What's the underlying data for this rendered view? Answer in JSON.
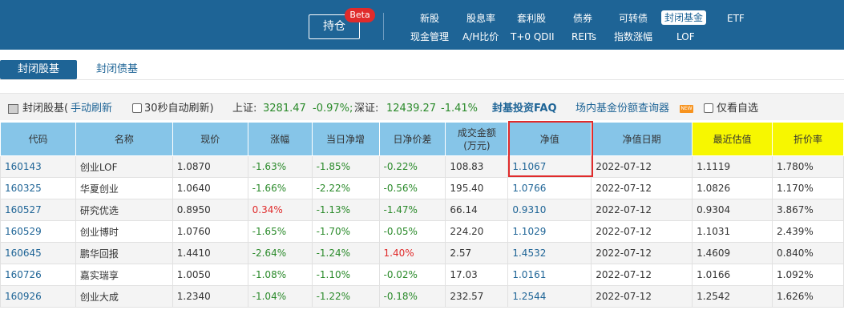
{
  "topbar": {
    "holding_label": "持仓",
    "beta_label": "Beta",
    "nav_row1": [
      "新股",
      "股息率",
      "套利股",
      "债券",
      "可转债",
      "封闭基金",
      "ETF"
    ],
    "nav_row2": [
      "现金管理",
      "A/H比价",
      "T+0 QDII",
      "REITs",
      "指数涨幅",
      "LOF"
    ],
    "active_nav": "封闭基金"
  },
  "tabs": [
    "封闭股基",
    "封闭债基"
  ],
  "infobar": {
    "title": "封闭股基(",
    "manual_refresh": "手动刷新",
    "auto_refresh": "30秒自动刷新)",
    "sh_label": "上证:",
    "sh_value": "3281.47",
    "sh_change": "-0.97%;",
    "sz_label": "深证:",
    "sz_value": "12439.27",
    "sz_change": "-1.41%",
    "faq_link": "封基投资FAQ",
    "query_link": "场内基金份额查询器",
    "new_badge": "NEW",
    "watchlist_only": "仅看自选"
  },
  "table": {
    "headers": [
      "代码",
      "名称",
      "现价",
      "涨幅",
      "当日净增",
      "日净价差",
      "成交金额(万元)",
      "净值",
      "净值日期",
      "最近估值",
      "折价率"
    ],
    "header_amount_line1": "成交金额",
    "header_amount_line2": "(万元)",
    "rows": [
      {
        "code": "160143",
        "name": "创业LOF",
        "price": "1.0870",
        "change": "-1.63%",
        "daily_nav_change": "-1.85%",
        "daily_spread": "-0.22%",
        "amount": "108.83",
        "nav": "1.1067",
        "nav_date": "2022-07-12",
        "est": "1.1119",
        "discount": "1.780%"
      },
      {
        "code": "160325",
        "name": "华夏创业",
        "price": "1.0640",
        "change": "-1.66%",
        "daily_nav_change": "-2.22%",
        "daily_spread": "-0.56%",
        "amount": "195.40",
        "nav": "1.0766",
        "nav_date": "2022-07-12",
        "est": "1.0826",
        "discount": "1.170%"
      },
      {
        "code": "160527",
        "name": "研究优选",
        "price": "0.8950",
        "change": "0.34%",
        "daily_nav_change": "-1.13%",
        "daily_spread": "-1.47%",
        "amount": "66.14",
        "nav": "0.9310",
        "nav_date": "2022-07-12",
        "est": "0.9304",
        "discount": "3.867%"
      },
      {
        "code": "160529",
        "name": "创业博时",
        "price": "1.0760",
        "change": "-1.65%",
        "daily_nav_change": "-1.70%",
        "daily_spread": "-0.05%",
        "amount": "224.20",
        "nav": "1.1029",
        "nav_date": "2022-07-12",
        "est": "1.1031",
        "discount": "2.439%"
      },
      {
        "code": "160645",
        "name": "鹏华回报",
        "price": "1.4410",
        "change": "-2.64%",
        "daily_nav_change": "-1.24%",
        "daily_spread": "1.40%",
        "amount": "2.57",
        "nav": "1.4532",
        "nav_date": "2022-07-12",
        "est": "1.4609",
        "discount": "0.840%"
      },
      {
        "code": "160726",
        "name": "嘉实瑞享",
        "price": "1.0050",
        "change": "-1.08%",
        "daily_nav_change": "-1.10%",
        "daily_spread": "-0.02%",
        "amount": "17.03",
        "nav": "1.0161",
        "nav_date": "2022-07-12",
        "est": "1.0166",
        "discount": "1.092%"
      },
      {
        "code": "160926",
        "name": "创业大成",
        "price": "1.2340",
        "change": "-1.04%",
        "daily_nav_change": "-1.22%",
        "daily_spread": "-0.18%",
        "amount": "232.57",
        "nav": "1.2544",
        "nav_date": "2022-07-12",
        "est": "1.2542",
        "discount": "1.626%"
      }
    ]
  },
  "colors": {
    "brand": "#1e6496",
    "header_blue": "#86c5e8",
    "header_yellow": "#f7f700",
    "up": "#e02b2b",
    "down": "#2a8a2a"
  }
}
